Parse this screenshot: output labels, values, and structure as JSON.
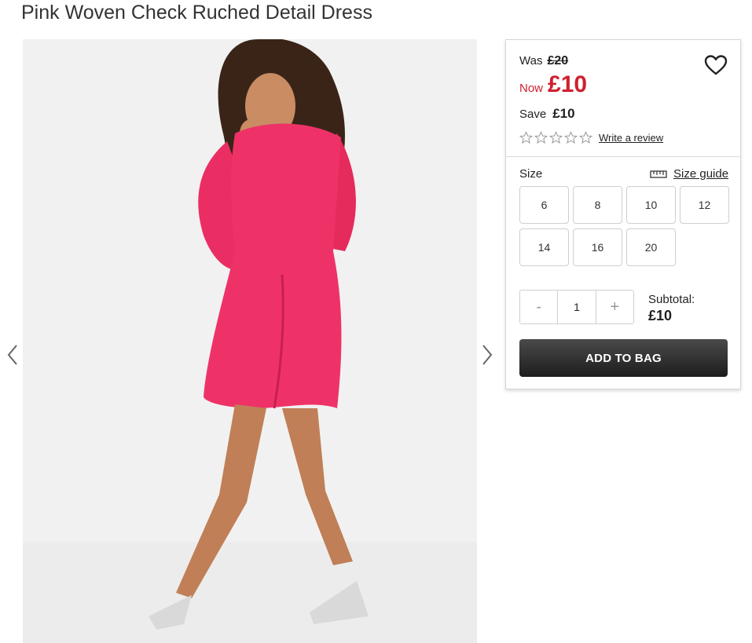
{
  "product": {
    "title": "Pink Woven Check Ruched Detail Dress"
  },
  "gallery": {
    "image_alt": "Model wearing pink ruched dress",
    "prev_icon": "chevron-left-icon",
    "next_icon": "chevron-right-icon"
  },
  "pricing": {
    "was_label": "Was",
    "was_price": "£20",
    "now_label": "Now",
    "now_price": "£10",
    "save_label": "Save",
    "save_value": "£10",
    "accent_color": "#d0202e"
  },
  "wishlist": {
    "icon": "heart-icon"
  },
  "rating": {
    "stars": 0,
    "max": 5,
    "review_link": "Write a review"
  },
  "size": {
    "label": "Size",
    "guide_label": "Size guide",
    "options": [
      "6",
      "8",
      "10",
      "12",
      "14",
      "16",
      "20"
    ]
  },
  "quantity": {
    "minus": "-",
    "value": "1",
    "plus": "+"
  },
  "subtotal": {
    "label": "Subtotal:",
    "value": "£10"
  },
  "cart": {
    "add_label": "ADD TO BAG"
  }
}
